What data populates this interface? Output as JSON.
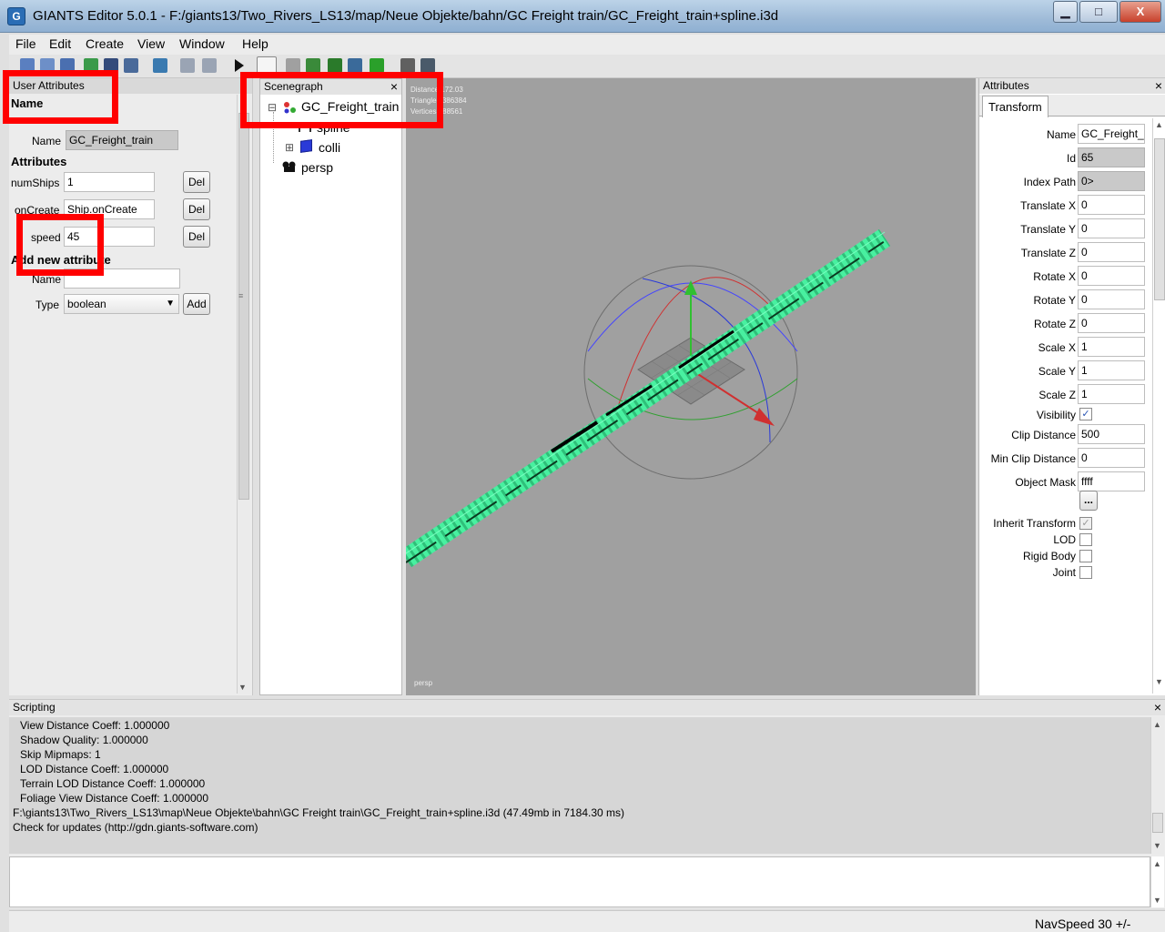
{
  "window": {
    "title": "GIANTS Editor 5.0.1 - F:/giants13/Two_Rivers_LS13/map/Neue Objekte/bahn/GC Freight train/GC_Freight_train+spline.i3d",
    "minimize": "▁",
    "maximize": "□",
    "close": "X"
  },
  "menu": [
    "File",
    "Edit",
    "Create",
    "View",
    "Window",
    "Help"
  ],
  "user_attributes": {
    "panel_title": "User Attributes",
    "name_heading": "Name",
    "name_label": "Name",
    "name_value": "GC_Freight_train",
    "attributes_heading": "Attributes",
    "rows": [
      {
        "label": "numShips",
        "value": "1",
        "button": "Del"
      },
      {
        "label": "onCreate",
        "value": "Ship.onCreate",
        "button": "Del"
      },
      {
        "label": "speed",
        "value": "45",
        "button": "Del"
      }
    ],
    "add_heading": "Add new attribute",
    "new_name_label": "Name",
    "new_name_value": "",
    "type_label": "Type",
    "type_value": "boolean",
    "add_button": "Add"
  },
  "scenegraph": {
    "title": "Scenegraph",
    "close": "×",
    "nodes": [
      {
        "label": "GC_Freight_train",
        "expander": "⊟"
      },
      {
        "label": "spline"
      },
      {
        "label": "colli",
        "expander": "⊞"
      },
      {
        "label": "persp"
      }
    ]
  },
  "viewport": {
    "stats": [
      "Distance 172.03",
      "Triangles 386384",
      "Vertices 488561"
    ],
    "camera": "persp"
  },
  "attributes": {
    "panel_title": "Attributes",
    "close": "×",
    "tab": "Transform",
    "fields": [
      {
        "label": "Name",
        "value": "GC_Freight_"
      },
      {
        "label": "Id",
        "value": "65"
      },
      {
        "label": "Index Path",
        "value": "0>"
      },
      {
        "label": "Translate X",
        "value": "0"
      },
      {
        "label": "Translate Y",
        "value": "0"
      },
      {
        "label": "Translate Z",
        "value": "0"
      },
      {
        "label": "Rotate X",
        "value": "0"
      },
      {
        "label": "Rotate Y",
        "value": "0"
      },
      {
        "label": "Rotate Z",
        "value": "0"
      },
      {
        "label": "Scale X",
        "value": "1"
      },
      {
        "label": "Scale Y",
        "value": "1"
      },
      {
        "label": "Scale Z",
        "value": "1"
      },
      {
        "label": "Visibility",
        "value": "✓"
      },
      {
        "label": "Clip Distance",
        "value": "500"
      },
      {
        "label": "Min Clip Distance",
        "value": "0"
      },
      {
        "label": "Object Mask",
        "value": "ffff"
      }
    ],
    "mask_button": "...",
    "checkboxes": [
      {
        "label": "Inherit Transform",
        "checked": "✓"
      },
      {
        "label": "LOD",
        "checked": ""
      },
      {
        "label": "Rigid Body",
        "checked": ""
      },
      {
        "label": "Joint",
        "checked": ""
      }
    ]
  },
  "scripting": {
    "title": "Scripting",
    "close": "×",
    "lines": [
      "View Distance Coeff: 1.000000",
      "Shadow Quality: 1.000000",
      "Skip Mipmaps: 1",
      "LOD Distance Coeff: 1.000000",
      "Terrain LOD Distance Coeff: 1.000000",
      "Foliage View Distance Coeff: 1.000000",
      "F:\\giants13\\Two_Rivers_LS13\\map\\Neue Objekte\\bahn\\GC Freight train\\GC_Freight_train+spline.i3d (47.49mb in 7184.30 ms)",
      "Check for updates (http://gdn.giants-software.com)"
    ]
  },
  "status": {
    "navspeed": "NavSpeed 30 +/-"
  },
  "colors": {
    "highlight": "#ff0000",
    "train": "#48f0a0",
    "viewport": "#a0a0a0"
  }
}
